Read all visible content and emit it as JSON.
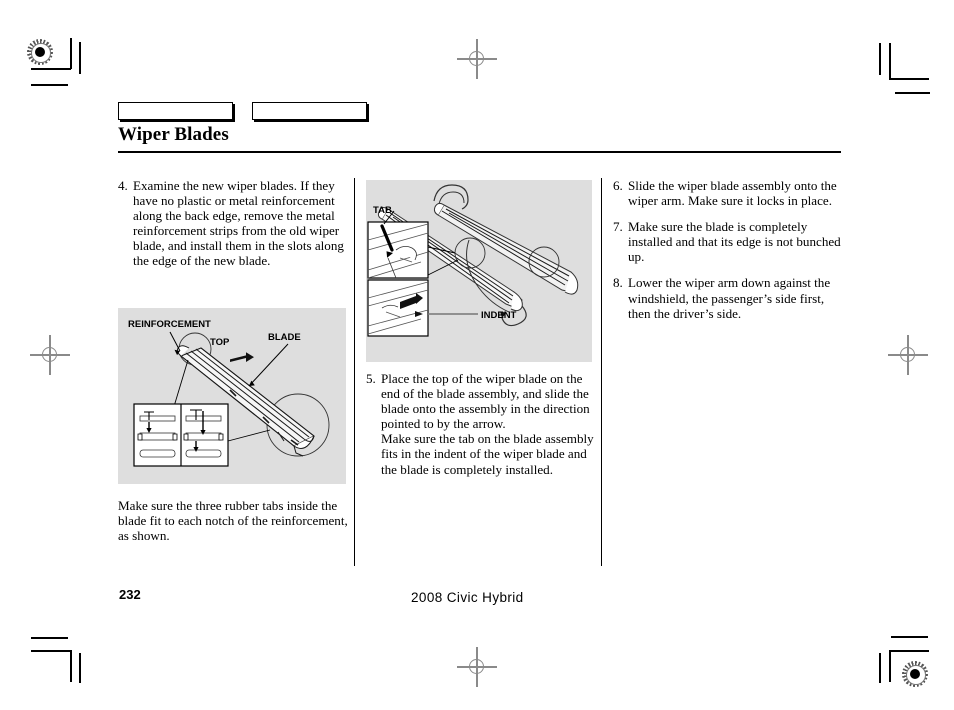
{
  "document": {
    "title": "Wiper Blades",
    "page_number": "232",
    "footer": "2008  Civic  Hybrid",
    "tabs": [
      "",
      ""
    ]
  },
  "columns": {
    "left": {
      "step": {
        "number": "4.",
        "text": "Examine the new wiper blades. If they have no plastic or metal reinforcement along the back edge, remove the metal reinforcement strips from the old wiper blade, and install them in the slots along the edge of the new blade."
      },
      "figure": {
        "name": "reinforcement-diagram",
        "labels": {
          "reinforcement": "REINFORCEMENT",
          "top": "TOP",
          "blade": "BLADE"
        }
      },
      "caption": "Make sure the three rubber tabs inside the blade fit to each notch of the reinforcement, as shown."
    },
    "middle": {
      "figure": {
        "name": "tab-indent-diagram",
        "labels": {
          "tab": "TAB",
          "indent": "INDENT"
        }
      },
      "step": {
        "number": "5.",
        "paragraph1": "Place the top of the wiper blade on the end of the blade assembly, and slide the blade onto the assembly in the direction pointed to by the arrow.",
        "paragraph2": "Make sure the tab on the blade assembly fits in the indent of the wiper blade and the blade is completely installed."
      }
    },
    "right": {
      "steps": [
        {
          "number": "6.",
          "text": "Slide the wiper blade assembly onto the wiper arm. Make sure it locks in place."
        },
        {
          "number": "7.",
          "text": "Make sure the blade is completely installed and that its edge is not bunched up."
        },
        {
          "number": "8.",
          "text": "Lower the wiper arm down against the windshield, the passenger’s side first, then the driver’s side."
        }
      ]
    }
  },
  "colors": {
    "figure_background": "#dedede",
    "ink": "#000000",
    "registration": "#8a8a8a"
  }
}
